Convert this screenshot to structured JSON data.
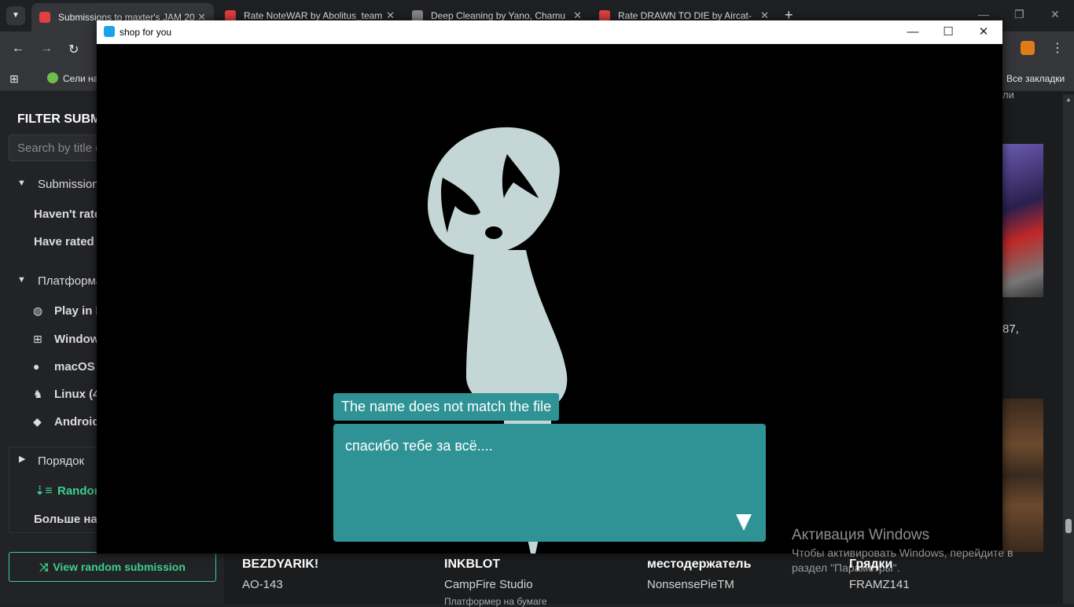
{
  "browser": {
    "tabs": [
      {
        "label": "Submissions to maxter's JAM 20",
        "active": true,
        "color": "#e04040"
      },
      {
        "label": "Rate NoteWAR by Abolitus_team",
        "active": false,
        "color": "#e04040"
      },
      {
        "label": "Deep Cleaning by Yano, Chamu",
        "active": false,
        "color": "#888888"
      },
      {
        "label": "Rate DRAWN TO DIE by Aircat-",
        "active": false,
        "color": "#e04040"
      }
    ],
    "bookmark_first": "Сели на",
    "bookmark_all": "Все закладки"
  },
  "sidebar": {
    "heading": "FILTER SUBM",
    "search_placeholder": "Search by title o",
    "submissions_label": "Submissions",
    "havent_rated": "Haven't rate",
    "have_rated": "Have rated (",
    "platforms_label": "Платформа",
    "platforms": [
      "Play in b",
      "Window",
      "macOS (",
      "Linux (4",
      "Android"
    ],
    "order_label": "Порядок",
    "random_label": "Random",
    "more_label": "Больше нас",
    "random_button": "View random submission"
  },
  "game": {
    "window_title": "shop for you",
    "speaker_name": "The name does not match the file",
    "dialog_text": "спасибо тебе за всё...."
  },
  "cards": [
    {
      "title": "BEZDYARIK!",
      "author": "AO-143"
    },
    {
      "title": "INKBLOT",
      "author": "CampFire Studio"
    },
    {
      "title": "местодержатель",
      "author": "NonsensePieTM"
    },
    {
      "title": "Грядки",
      "author": "FRAMZ141"
    }
  ],
  "cards_partial": "Платформер на бумаге",
  "right_edge_text": "87,",
  "right_edge_small": "ли",
  "activation": {
    "title": "Активация Windows",
    "line1": "Чтобы активировать Windows, перейдите в",
    "line2": "раздел \"Параметры\"."
  },
  "colors": {
    "dialog": "#2f9396",
    "accent": "#3ecf8e",
    "character": "#c5d6d6"
  }
}
